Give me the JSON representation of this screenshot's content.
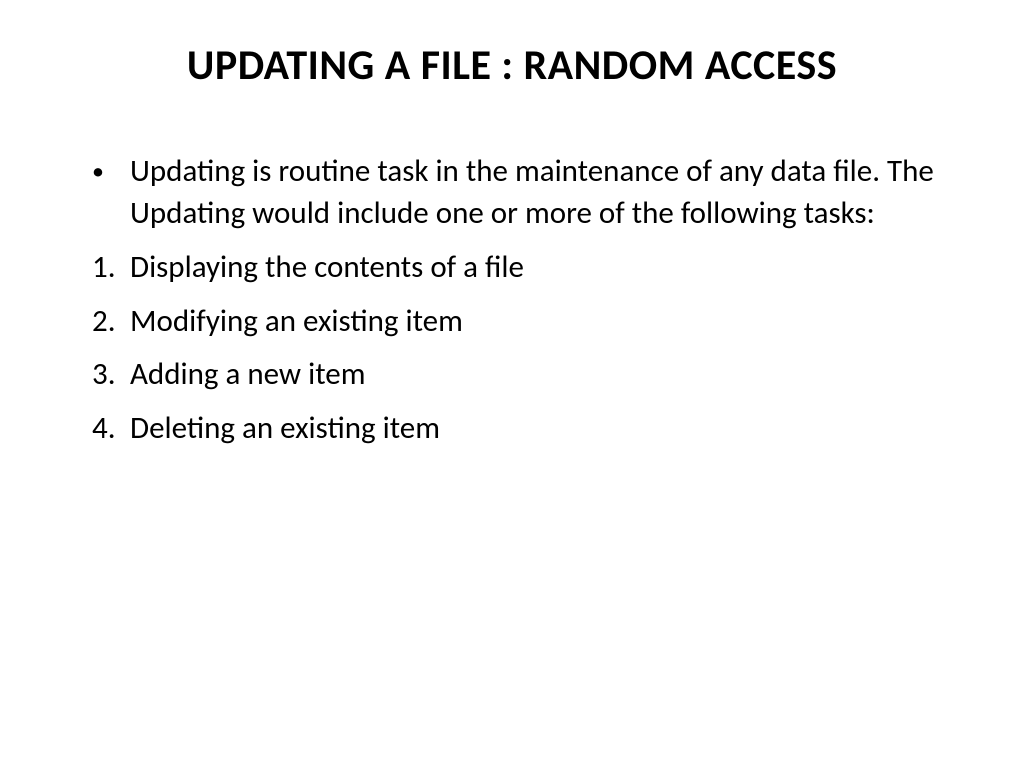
{
  "slide": {
    "title": "UPDATING A FILE : RANDOM ACCESS",
    "intro": "Updating is routine task in the maintenance of any data file. The Updating would include one or more of the following tasks:",
    "items": [
      {
        "num": "1.",
        "text": "Displaying the contents of a file"
      },
      {
        "num": "2.",
        "text": "Modifying an existing item"
      },
      {
        "num": "3.",
        "text": "Adding a new item"
      },
      {
        "num": "4.",
        "text": "Deleting an existing item"
      }
    ],
    "bullet_char": "•"
  }
}
